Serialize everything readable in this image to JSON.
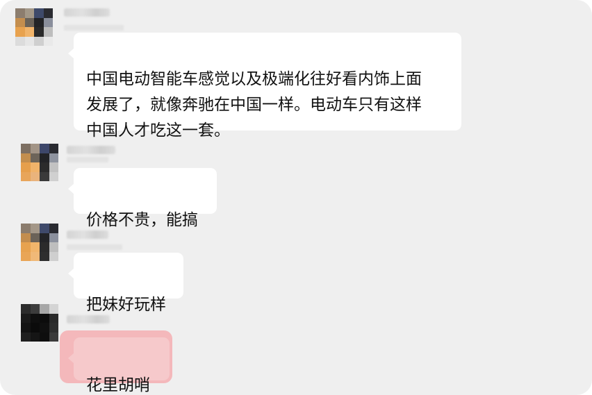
{
  "conversation": {
    "messages": [
      {
        "sender_name": "",
        "text": "中国电动智能车感觉以及极端化往好看内饰上面\n发展了，就像奔驰在中国一样。电动车只有这样\n中国人才吃这一套。",
        "highlighted": false
      },
      {
        "sender_name": "",
        "text": "价格不贵，能搞",
        "highlighted": false
      },
      {
        "sender_name": "",
        "text": "把妹好玩样",
        "highlighted": false
      },
      {
        "sender_name": "",
        "text": "花里胡哨",
        "highlighted": true
      }
    ]
  },
  "colors": {
    "background": "#efefef",
    "bubble": "#ffffff",
    "highlight": "#f4b8bb",
    "text": "#111111"
  }
}
